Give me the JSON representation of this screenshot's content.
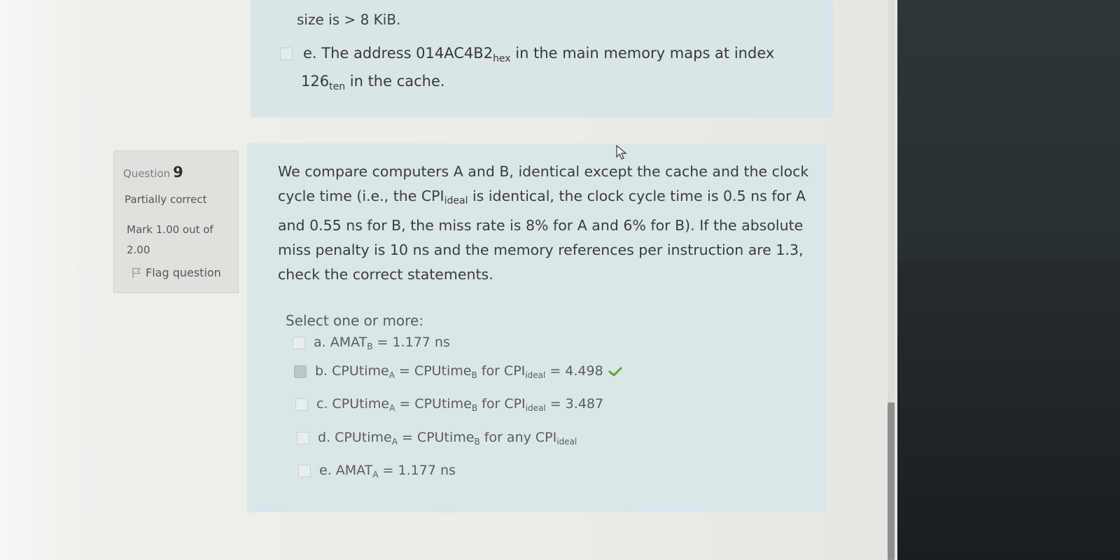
{
  "previous_question": {
    "line1": "size is > 8 KiB.",
    "option_e": {
      "line1_prefix": "e. The address 014AC4B2",
      "line1_sub": "hex",
      "line1_suffix": " in the main memory maps at index",
      "line2_prefix": "126",
      "line2_sub": "ten",
      "line2_suffix": " in the cache."
    }
  },
  "question_info": {
    "label": "Question",
    "number": "9",
    "state": "Partially correct",
    "mark": "Mark 1.00 out of 2.00",
    "flag": "Flag question"
  },
  "question": {
    "text_l1": "We compare computers A and B, identical except the cache and the clock",
    "text_l2_a": "cycle time (i.e., the CPI",
    "text_l2_sub": "ideal",
    "text_l2_b": " is identical, the clock cycle time is 0.5 ns for A",
    "text_l3": "and 0.55 ns for B, the miss rate is 8% for A and 6% for B). If the absolute",
    "text_l4": "miss penalty is 10 ns and the memory references per instruction are 1.3,",
    "text_l5": "check the correct statements.",
    "prompt": "Select one or more:",
    "options": [
      {
        "prefix": "a. AMAT",
        "sub1": "B",
        "mid": " = 1.177 ns",
        "sub2": "",
        "tail": "",
        "checked": false,
        "correct": false
      },
      {
        "prefix": "b. CPUtime",
        "sub1": "A",
        "mid": " = CPUtime",
        "sub1b": "B",
        "mid2": " for CPI",
        "sub2": "ideal",
        "tail": " = 4.498",
        "checked": true,
        "correct": true
      },
      {
        "prefix": "c. CPUtime",
        "sub1": "A",
        "mid": " = CPUtime",
        "sub1b": "B",
        "mid2": " for CPI",
        "sub2": "ideal",
        "tail": " = 3.487",
        "checked": false,
        "correct": false
      },
      {
        "prefix": "d. CPUtime",
        "sub1": "A",
        "mid": " = CPUtime",
        "sub1b": "B",
        "mid2": " for any CPI",
        "sub2": "ideal",
        "tail": "",
        "checked": false,
        "correct": false
      },
      {
        "prefix": "e. AMAT",
        "sub1": "A",
        "mid": " = 1.177 ns",
        "sub2": "",
        "tail": "",
        "checked": false,
        "correct": false
      }
    ]
  },
  "icons": {
    "flag": "flag-icon",
    "correct": "check-icon",
    "cursor": "cursor-icon"
  },
  "colors": {
    "correct": "#5fa532",
    "box_bg": "#d9e7e9"
  }
}
